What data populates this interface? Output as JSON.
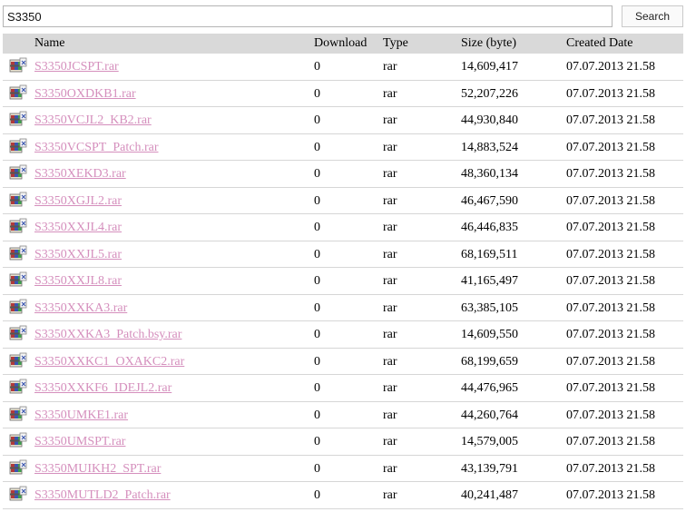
{
  "search": {
    "value": "S3350",
    "button_label": "Search"
  },
  "table": {
    "headers": {
      "name": "Name",
      "download": "Download",
      "type": "Type",
      "size": "Size (byte)",
      "date": "Created Date"
    },
    "rows": [
      {
        "name": "S3350JCSPT.rar",
        "download": "0",
        "type": "rar",
        "size": "14,609,417",
        "date": "07.07.2013 21.58"
      },
      {
        "name": "S3350OXDKB1.rar",
        "download": "0",
        "type": "rar",
        "size": "52,207,226",
        "date": "07.07.2013 21.58"
      },
      {
        "name": "S3350VCJL2_KB2.rar",
        "download": "0",
        "type": "rar",
        "size": "44,930,840",
        "date": "07.07.2013 21.58"
      },
      {
        "name": "S3350VCSPT_Patch.rar",
        "download": "0",
        "type": "rar",
        "size": "14,883,524",
        "date": "07.07.2013 21.58"
      },
      {
        "name": "S3350XEKD3.rar",
        "download": "0",
        "type": "rar",
        "size": "48,360,134",
        "date": "07.07.2013 21.58"
      },
      {
        "name": "S3350XGJL2.rar",
        "download": "0",
        "type": "rar",
        "size": "46,467,590",
        "date": "07.07.2013 21.58"
      },
      {
        "name": "S3350XXJL4.rar",
        "download": "0",
        "type": "rar",
        "size": "46,446,835",
        "date": "07.07.2013 21.58"
      },
      {
        "name": "S3350XXJL5.rar",
        "download": "0",
        "type": "rar",
        "size": "68,169,511",
        "date": "07.07.2013 21.58"
      },
      {
        "name": "S3350XXJL8.rar",
        "download": "0",
        "type": "rar",
        "size": "41,165,497",
        "date": "07.07.2013 21.58"
      },
      {
        "name": "S3350XXKA3.rar",
        "download": "0",
        "type": "rar",
        "size": "63,385,105",
        "date": "07.07.2013 21.58"
      },
      {
        "name": "S3350XXKA3_Patch.bsy.rar",
        "download": "0",
        "type": "rar",
        "size": "14,609,550",
        "date": "07.07.2013 21.58"
      },
      {
        "name": "S3350XXKC1_OXAKC2.rar",
        "download": "0",
        "type": "rar",
        "size": "68,199,659",
        "date": "07.07.2013 21.58"
      },
      {
        "name": "S3350XXKF6_IDEJL2.rar",
        "download": "0",
        "type": "rar",
        "size": "44,476,965",
        "date": "07.07.2013 21.58"
      },
      {
        "name": "S3350UMKE1.rar",
        "download": "0",
        "type": "rar",
        "size": "44,260,764",
        "date": "07.07.2013 21.58"
      },
      {
        "name": "S3350UMSPT.rar",
        "download": "0",
        "type": "rar",
        "size": "14,579,005",
        "date": "07.07.2013 21.58"
      },
      {
        "name": "S3350MUIKH2_SPT.rar",
        "download": "0",
        "type": "rar",
        "size": "43,139,791",
        "date": "07.07.2013 21.58"
      },
      {
        "name": "S3350MUTLD2_Patch.rar",
        "download": "0",
        "type": "rar",
        "size": "40,241,487",
        "date": "07.07.2013 21.58"
      }
    ]
  }
}
